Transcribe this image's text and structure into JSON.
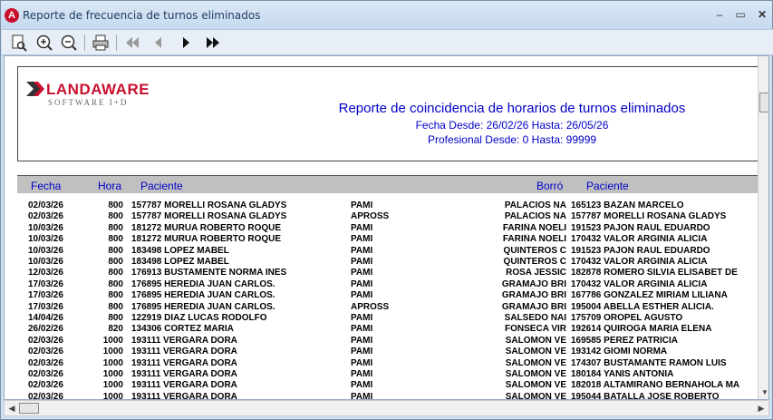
{
  "window": {
    "title": "Reporte de frecuencia de turnos eliminados",
    "app_icon_letter": "A"
  },
  "toolbar": {
    "buttons": [
      "page-preview-icon",
      "zoom-in-icon",
      "zoom-out-icon",
      "print-icon",
      "first-page-icon",
      "previous-page-icon",
      "next-page-icon",
      "last-page-icon"
    ]
  },
  "report": {
    "logo_brand": "LANDAWARE",
    "logo_tagline": "SOFTWARE I+D",
    "title": "Reporte de coincidencia de horarios de turnos eliminados",
    "date_range": "Fecha Desde: 26/02/26 Hasta: 26/05/26",
    "professional_range": "Profesional Desde: 0 Hasta: 99999",
    "columns": {
      "fecha": "Fecha",
      "hora": "Hora",
      "paciente": "Paciente",
      "borro": "Borró",
      "paciente2": "Paciente"
    },
    "rows": [
      [
        "02/03/26",
        "800",
        "157787",
        "MORELLI ROSANA GLADYS",
        "PAMI",
        "PALACIOS NA",
        "165123",
        "BAZAN MARCELO"
      ],
      [
        "02/03/26",
        "800",
        "157787",
        "MORELLI ROSANA GLADYS",
        "APROSS",
        "PALACIOS NA",
        "157787",
        "MORELLI ROSANA GLADYS"
      ],
      [
        "10/03/26",
        "800",
        "181272",
        "MURUA ROBERTO ROQUE",
        "PAMI",
        "FARIÑA NOELI",
        "191523",
        "PAJON RAUL EDUARDO"
      ],
      [
        "10/03/26",
        "800",
        "181272",
        "MURUA ROBERTO ROQUE",
        "PAMI",
        "FARIÑA NOELI",
        "170432",
        "VALOR ARGINIA ALICIA"
      ],
      [
        "10/03/26",
        "800",
        "183498",
        "LOPEZ MABEL",
        "PAMI",
        "QUINTEROS C",
        "191523",
        "PAJON RAUL EDUARDO"
      ],
      [
        "10/03/26",
        "800",
        "183498",
        "LOPEZ MABEL",
        "PAMI",
        "QUINTEROS C",
        "170432",
        "VALOR ARGINIA ALICIA"
      ],
      [
        "12/03/26",
        "800",
        "176913",
        "BUSTAMENTE NORMA INES",
        "PAMI",
        "ROSA JESSIC",
        "182878",
        "ROMERO SILVIA ELISABET DE"
      ],
      [
        "17/03/26",
        "800",
        "176895",
        "HEREDIA JUAN CARLOS.",
        "PAMI",
        "GRAMAJO BRI",
        "170432",
        "VALOR ARGINIA ALICIA"
      ],
      [
        "17/03/26",
        "800",
        "176895",
        "HEREDIA JUAN CARLOS.",
        "PAMI",
        "GRAMAJO BRI",
        "167786",
        "GONZALEZ MIRIAM LILIANA"
      ],
      [
        "17/03/26",
        "800",
        "176895",
        "HEREDIA JUAN CARLOS.",
        "APROSS",
        "GRAMAJO BRI",
        "195004",
        "ABELLA ESTHER ALICIA."
      ],
      [
        "14/04/26",
        "800",
        "122919",
        "DIAZ LUCAS RODOLFO",
        "PAMI",
        "SALSEDO NAI",
        "175709",
        "OROPEL AGUSTO"
      ],
      [
        "26/02/26",
        "820",
        "134306",
        "CORTEZ MARIA",
        "PAMI",
        "FONSECA VIR",
        "192614",
        "QUIROGA MARIA ELENA"
      ],
      [
        "02/03/26",
        "1000",
        "193111",
        "VERGARA DORA",
        "PAMI",
        "SALOMON VE",
        "169585",
        "PEREZ PATRICIA"
      ],
      [
        "02/03/26",
        "1000",
        "193111",
        "VERGARA DORA",
        "PAMI",
        "SALOMON VE",
        "193142",
        "GIOMI NORMA"
      ],
      [
        "02/03/26",
        "1000",
        "193111",
        "VERGARA DORA",
        "PAMI",
        "SALOMON VE",
        "174307",
        "BUSTAMANTE RAMON LUIS"
      ],
      [
        "02/03/26",
        "1000",
        "193111",
        "VERGARA DORA",
        "PAMI",
        "SALOMON VE",
        "180184",
        "YANIS ANTONIA"
      ],
      [
        "02/03/26",
        "1000",
        "193111",
        "VERGARA DORA",
        "PAMI",
        "SALOMON VE",
        "182018",
        "ALTAMIRANO BERNAHOLA MA"
      ],
      [
        "02/03/26",
        "1000",
        "193111",
        "VERGARA DORA",
        "PAMI",
        "SALOMON VE",
        "195044",
        "BATALLA JOSE ROBERTO"
      ]
    ]
  },
  "colors": {
    "accent_blue": "#0000c8",
    "brand_red": "#c8102e"
  }
}
